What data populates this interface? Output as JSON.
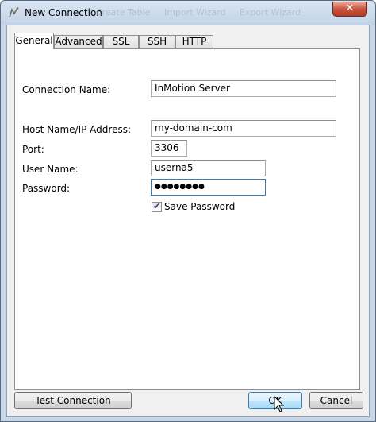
{
  "window": {
    "title": "New Connection",
    "toolbar_ghost": [
      "Create Table",
      "Import Wizard",
      "Export Wizard"
    ]
  },
  "tabs": [
    {
      "label": "General",
      "active": true
    },
    {
      "label": "Advanced",
      "active": false
    },
    {
      "label": "SSL",
      "active": false
    },
    {
      "label": "SSH",
      "active": false
    },
    {
      "label": "HTTP",
      "active": false
    }
  ],
  "form": {
    "connection_name": {
      "label": "Connection Name:",
      "value": "InMotion Server"
    },
    "host": {
      "label": "Host Name/IP Address:",
      "value": "my-domain-com"
    },
    "port": {
      "label": "Port:",
      "value": "3306"
    },
    "user": {
      "label": "User Name:",
      "value": "userna5"
    },
    "password": {
      "label": "Password:",
      "value": "●●●●●●●●"
    },
    "save_password": {
      "label": "Save Password",
      "checked": true
    }
  },
  "buttons": {
    "test_connection": "Test Connection",
    "ok": "OK",
    "cancel": "Cancel",
    "close": "✕"
  },
  "colors": {
    "title_bar": "#c3d3e6",
    "close_button": "#c8533e",
    "default_button": "#a7d9f5",
    "focus_border": "#3d7bad"
  }
}
